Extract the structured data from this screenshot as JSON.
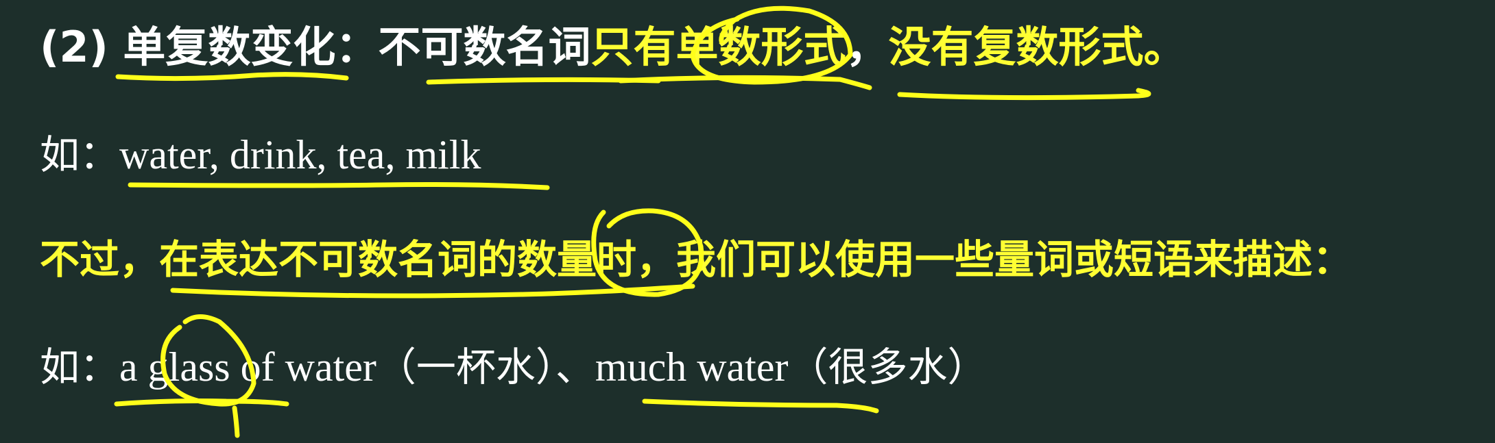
{
  "line1": {
    "number": "(2)",
    "topic": "单复数变化",
    "colon": "：",
    "subject": "不可数名词",
    "part_a": "只有单数形式",
    "comma": "，",
    "part_b": "没有复数形式",
    "period": "。"
  },
  "line2": {
    "prefix": "如：",
    "examples": "water, drink,  tea, milk"
  },
  "line3": {
    "text": "不过，在表达不可数名词的数量时，我们可以使用一些量词或短语来描述："
  },
  "line4": {
    "prefix": "如：",
    "example1": "a glass of water",
    "gloss1": "（一杯水）",
    "separator": "、",
    "example2": "much water",
    "gloss2": "（很多水）"
  },
  "colors": {
    "background": "#1d2f2b",
    "highlight": "#ffff33",
    "text": "#ffffff",
    "annotation_ink": "#ffff1a"
  }
}
